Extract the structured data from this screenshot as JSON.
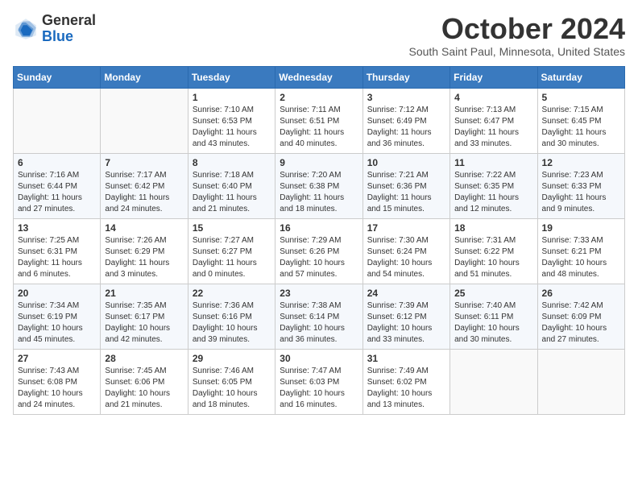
{
  "header": {
    "logo_general": "General",
    "logo_blue": "Blue",
    "month_title": "October 2024",
    "subtitle": "South Saint Paul, Minnesota, United States"
  },
  "weekdays": [
    "Sunday",
    "Monday",
    "Tuesday",
    "Wednesday",
    "Thursday",
    "Friday",
    "Saturday"
  ],
  "weeks": [
    [
      {
        "day": "",
        "info": ""
      },
      {
        "day": "",
        "info": ""
      },
      {
        "day": "1",
        "info": "Sunrise: 7:10 AM\nSunset: 6:53 PM\nDaylight: 11 hours and 43 minutes."
      },
      {
        "day": "2",
        "info": "Sunrise: 7:11 AM\nSunset: 6:51 PM\nDaylight: 11 hours and 40 minutes."
      },
      {
        "day": "3",
        "info": "Sunrise: 7:12 AM\nSunset: 6:49 PM\nDaylight: 11 hours and 36 minutes."
      },
      {
        "day": "4",
        "info": "Sunrise: 7:13 AM\nSunset: 6:47 PM\nDaylight: 11 hours and 33 minutes."
      },
      {
        "day": "5",
        "info": "Sunrise: 7:15 AM\nSunset: 6:45 PM\nDaylight: 11 hours and 30 minutes."
      }
    ],
    [
      {
        "day": "6",
        "info": "Sunrise: 7:16 AM\nSunset: 6:44 PM\nDaylight: 11 hours and 27 minutes."
      },
      {
        "day": "7",
        "info": "Sunrise: 7:17 AM\nSunset: 6:42 PM\nDaylight: 11 hours and 24 minutes."
      },
      {
        "day": "8",
        "info": "Sunrise: 7:18 AM\nSunset: 6:40 PM\nDaylight: 11 hours and 21 minutes."
      },
      {
        "day": "9",
        "info": "Sunrise: 7:20 AM\nSunset: 6:38 PM\nDaylight: 11 hours and 18 minutes."
      },
      {
        "day": "10",
        "info": "Sunrise: 7:21 AM\nSunset: 6:36 PM\nDaylight: 11 hours and 15 minutes."
      },
      {
        "day": "11",
        "info": "Sunrise: 7:22 AM\nSunset: 6:35 PM\nDaylight: 11 hours and 12 minutes."
      },
      {
        "day": "12",
        "info": "Sunrise: 7:23 AM\nSunset: 6:33 PM\nDaylight: 11 hours and 9 minutes."
      }
    ],
    [
      {
        "day": "13",
        "info": "Sunrise: 7:25 AM\nSunset: 6:31 PM\nDaylight: 11 hours and 6 minutes."
      },
      {
        "day": "14",
        "info": "Sunrise: 7:26 AM\nSunset: 6:29 PM\nDaylight: 11 hours and 3 minutes."
      },
      {
        "day": "15",
        "info": "Sunrise: 7:27 AM\nSunset: 6:27 PM\nDaylight: 11 hours and 0 minutes."
      },
      {
        "day": "16",
        "info": "Sunrise: 7:29 AM\nSunset: 6:26 PM\nDaylight: 10 hours and 57 minutes."
      },
      {
        "day": "17",
        "info": "Sunrise: 7:30 AM\nSunset: 6:24 PM\nDaylight: 10 hours and 54 minutes."
      },
      {
        "day": "18",
        "info": "Sunrise: 7:31 AM\nSunset: 6:22 PM\nDaylight: 10 hours and 51 minutes."
      },
      {
        "day": "19",
        "info": "Sunrise: 7:33 AM\nSunset: 6:21 PM\nDaylight: 10 hours and 48 minutes."
      }
    ],
    [
      {
        "day": "20",
        "info": "Sunrise: 7:34 AM\nSunset: 6:19 PM\nDaylight: 10 hours and 45 minutes."
      },
      {
        "day": "21",
        "info": "Sunrise: 7:35 AM\nSunset: 6:17 PM\nDaylight: 10 hours and 42 minutes."
      },
      {
        "day": "22",
        "info": "Sunrise: 7:36 AM\nSunset: 6:16 PM\nDaylight: 10 hours and 39 minutes."
      },
      {
        "day": "23",
        "info": "Sunrise: 7:38 AM\nSunset: 6:14 PM\nDaylight: 10 hours and 36 minutes."
      },
      {
        "day": "24",
        "info": "Sunrise: 7:39 AM\nSunset: 6:12 PM\nDaylight: 10 hours and 33 minutes."
      },
      {
        "day": "25",
        "info": "Sunrise: 7:40 AM\nSunset: 6:11 PM\nDaylight: 10 hours and 30 minutes."
      },
      {
        "day": "26",
        "info": "Sunrise: 7:42 AM\nSunset: 6:09 PM\nDaylight: 10 hours and 27 minutes."
      }
    ],
    [
      {
        "day": "27",
        "info": "Sunrise: 7:43 AM\nSunset: 6:08 PM\nDaylight: 10 hours and 24 minutes."
      },
      {
        "day": "28",
        "info": "Sunrise: 7:45 AM\nSunset: 6:06 PM\nDaylight: 10 hours and 21 minutes."
      },
      {
        "day": "29",
        "info": "Sunrise: 7:46 AM\nSunset: 6:05 PM\nDaylight: 10 hours and 18 minutes."
      },
      {
        "day": "30",
        "info": "Sunrise: 7:47 AM\nSunset: 6:03 PM\nDaylight: 10 hours and 16 minutes."
      },
      {
        "day": "31",
        "info": "Sunrise: 7:49 AM\nSunset: 6:02 PM\nDaylight: 10 hours and 13 minutes."
      },
      {
        "day": "",
        "info": ""
      },
      {
        "day": "",
        "info": ""
      }
    ]
  ]
}
